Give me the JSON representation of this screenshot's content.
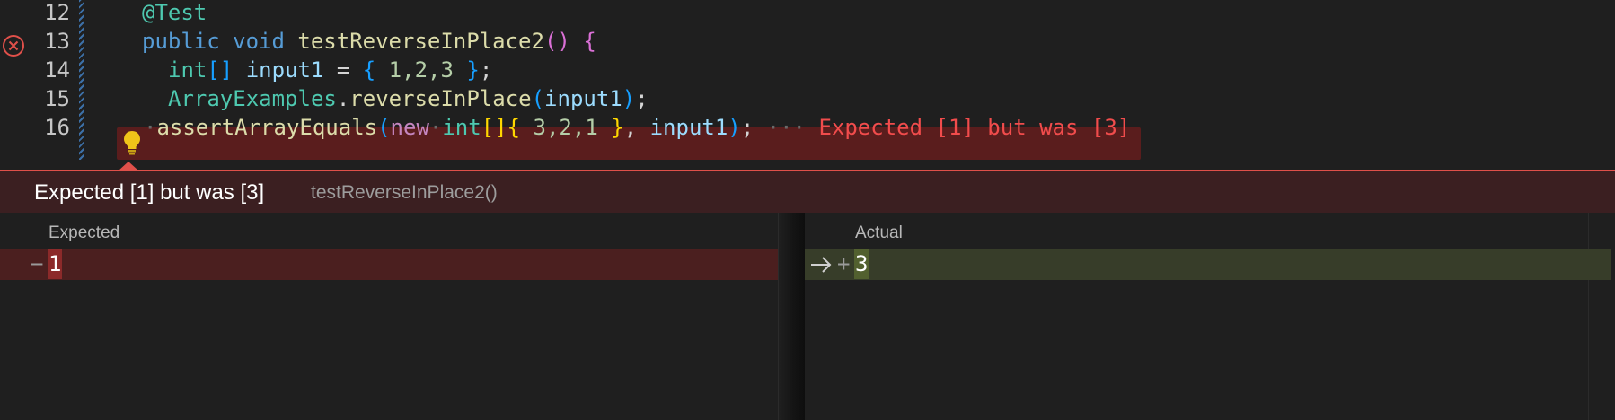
{
  "editor": {
    "lines": [
      {
        "num": "12"
      },
      {
        "num": "13"
      },
      {
        "num": "14"
      },
      {
        "num": "15"
      },
      {
        "num": "16"
      }
    ],
    "code": {
      "l12_annotation": "@Test",
      "l13_public": "public",
      "l13_void": "void",
      "l13_method": "testReverseInPlace2",
      "l13_parens": "()",
      "l13_brace": "{",
      "l14_type": "int",
      "l14_brackets": "[]",
      "l14_var": "input1",
      "l14_eq": " = ",
      "l14_open": "{",
      "l14_nums": " 1,2,3 ",
      "l14_close": "}",
      "l14_semi": ";",
      "l15_class": "ArrayExamples",
      "l15_dot": ".",
      "l15_method": "reverseInPlace",
      "l15_open": "(",
      "l15_arg": "input1",
      "l15_close": ")",
      "l15_semi": ";",
      "l16_method": "assertArrayEquals",
      "l16_open": "(",
      "l16_new": "new",
      "l16_type": "int",
      "l16_brackets": "[]",
      "l16_brace_open": "{",
      "l16_nums": " 3,2,1 ",
      "l16_brace_close": "}",
      "l16_comma": ", ",
      "l16_arg": "input1",
      "l16_close": ")",
      "l16_semi": ";",
      "l16_inline_error": "Expected [1] but was [3]"
    },
    "error_icon": "circle-x-icon",
    "lightbulb_icon": "lightbulb-icon"
  },
  "peek": {
    "title": "Expected [1] but was [3]",
    "subtitle": "testReverseInPlace2()"
  },
  "diff": {
    "expected_label": "Expected",
    "actual_label": "Actual",
    "expected_sign": "−",
    "expected_value": "1",
    "actual_sign": "+",
    "actual_value": "3"
  },
  "colors": {
    "error_accent": "#e0504a",
    "removed_bg": "#4b1f1f",
    "added_bg": "#373d29"
  }
}
